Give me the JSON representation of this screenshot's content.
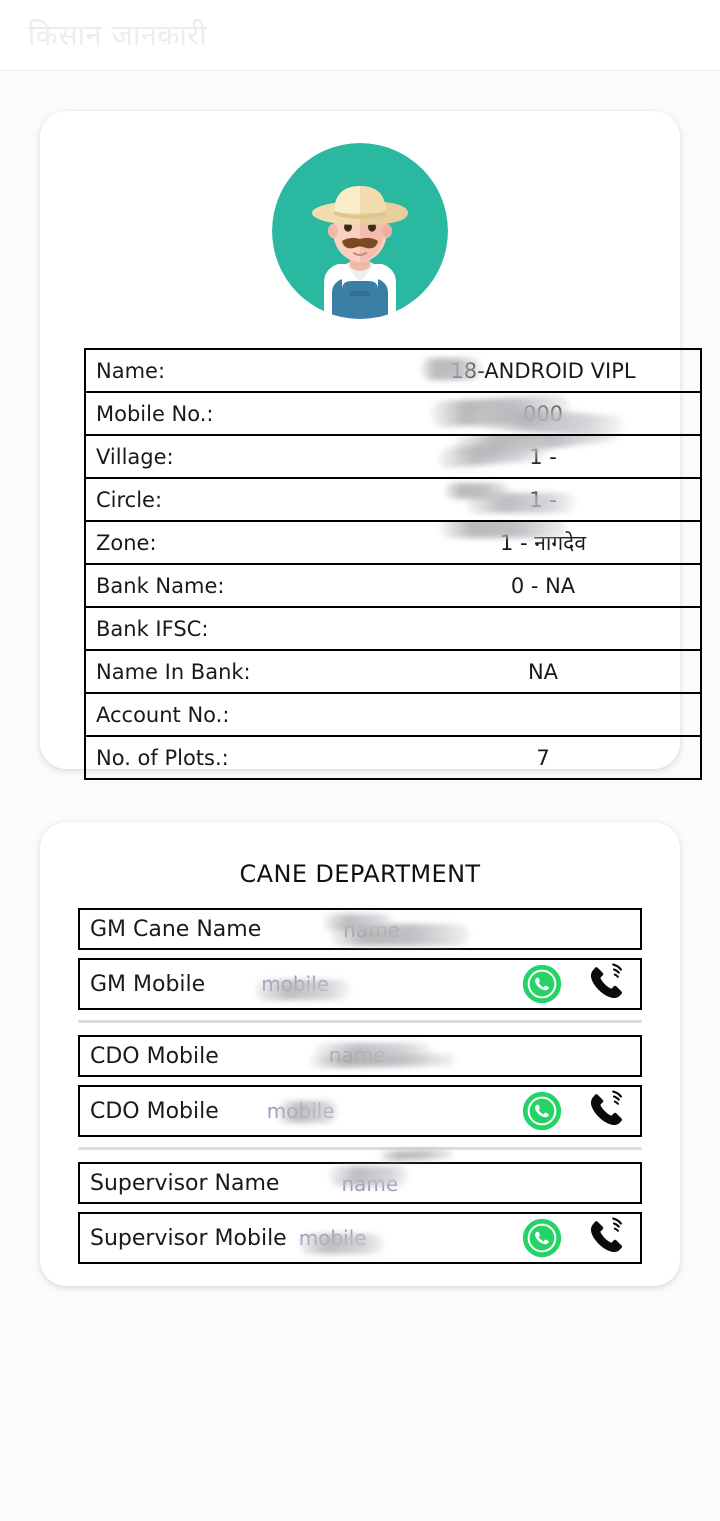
{
  "app": {
    "title": "किसान जानकारी"
  },
  "profile": {
    "avatar_icon": "farmer-avatar-icon",
    "avatar_bg_color": "#2ab8a0",
    "rows": [
      {
        "label": "Name:",
        "value": "18-ANDROID VIPL",
        "redacted": true
      },
      {
        "label": "Mobile No.:",
        "value": "000",
        "redacted": true
      },
      {
        "label": "Village:",
        "value": "1 -",
        "redacted": true
      },
      {
        "label": "Circle:",
        "value": "1 -",
        "redacted": true
      },
      {
        "label": "Zone:",
        "value": "1 - नागदेव",
        "redacted": true
      },
      {
        "label": "Bank Name:",
        "value": "0 - NA",
        "redacted": false
      },
      {
        "label": "Bank IFSC:",
        "value": "",
        "redacted": false
      },
      {
        "label": "Name In Bank:",
        "value": "NA",
        "redacted": false
      },
      {
        "label": "Account No.:",
        "value": "",
        "redacted": false
      },
      {
        "label": "No. of Plots.:",
        "value": "7",
        "redacted": false
      }
    ]
  },
  "department": {
    "title": "CANE DEPARTMENT",
    "whatsapp_icon": "whatsapp-icon",
    "call_icon": "phone-call-icon",
    "whatsapp_color": "#25d366",
    "groups": [
      {
        "rows": [
          {
            "label": "GM Cane Name",
            "value": "name",
            "has_icons": false,
            "redacted": true
          },
          {
            "label": "GM Mobile",
            "value": "mobile",
            "has_icons": true,
            "redacted": true
          }
        ]
      },
      {
        "rows": [
          {
            "label": "CDO Mobile",
            "value": "name",
            "has_icons": false,
            "redacted": true
          },
          {
            "label": "CDO Mobile",
            "value": "mobile",
            "has_icons": true,
            "redacted": true
          }
        ]
      },
      {
        "rows": [
          {
            "label": "Supervisor Name",
            "value": "name",
            "has_icons": false,
            "redacted": true
          },
          {
            "label": "Supervisor Mobile",
            "value": "mobile",
            "has_icons": true,
            "redacted": true
          }
        ]
      }
    ]
  }
}
